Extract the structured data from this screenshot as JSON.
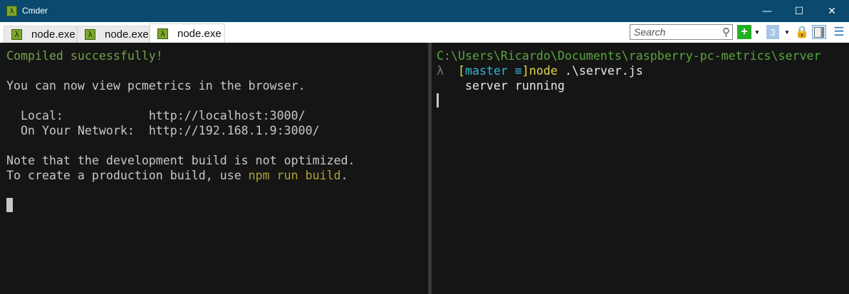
{
  "window": {
    "title": "Cmder",
    "icon": "lambda-icon",
    "controls": [
      "minimize",
      "maximize",
      "close"
    ]
  },
  "tabs": [
    {
      "label": "node.exe",
      "active": false
    },
    {
      "label": "node.exe",
      "active": false
    },
    {
      "label": "node.exe",
      "active": true
    }
  ],
  "toolbar": {
    "search_placeholder": "Search",
    "new_console": "plus-icon",
    "console_number": "3",
    "lock": "lock-icon",
    "split": "split-view-icon",
    "menu": "hamburger-icon"
  },
  "left_pane": {
    "compiled": "Compiled successfully!",
    "view": "You can now view pcmetrics in the browser.",
    "local_label": "  Local:            ",
    "local_url": "http://localhost:3000/",
    "network_label": "  On Your Network:  ",
    "network_url": "http://192.168.1.9:3000/",
    "note": "Note that the development build is not optimized.",
    "prod_prefix": "To create a production build, use ",
    "prod_cmd": "npm run build",
    "prod_suffix": "."
  },
  "right_pane": {
    "path": "C:\\Users\\Ricardo\\Documents\\raspberry-pc-metrics\\server",
    "prompt": "λ  ",
    "bracket_open": "[",
    "branch": "master ≡",
    "bracket_close": "]",
    "command": "node .\\server.js",
    "output": "    server running"
  }
}
